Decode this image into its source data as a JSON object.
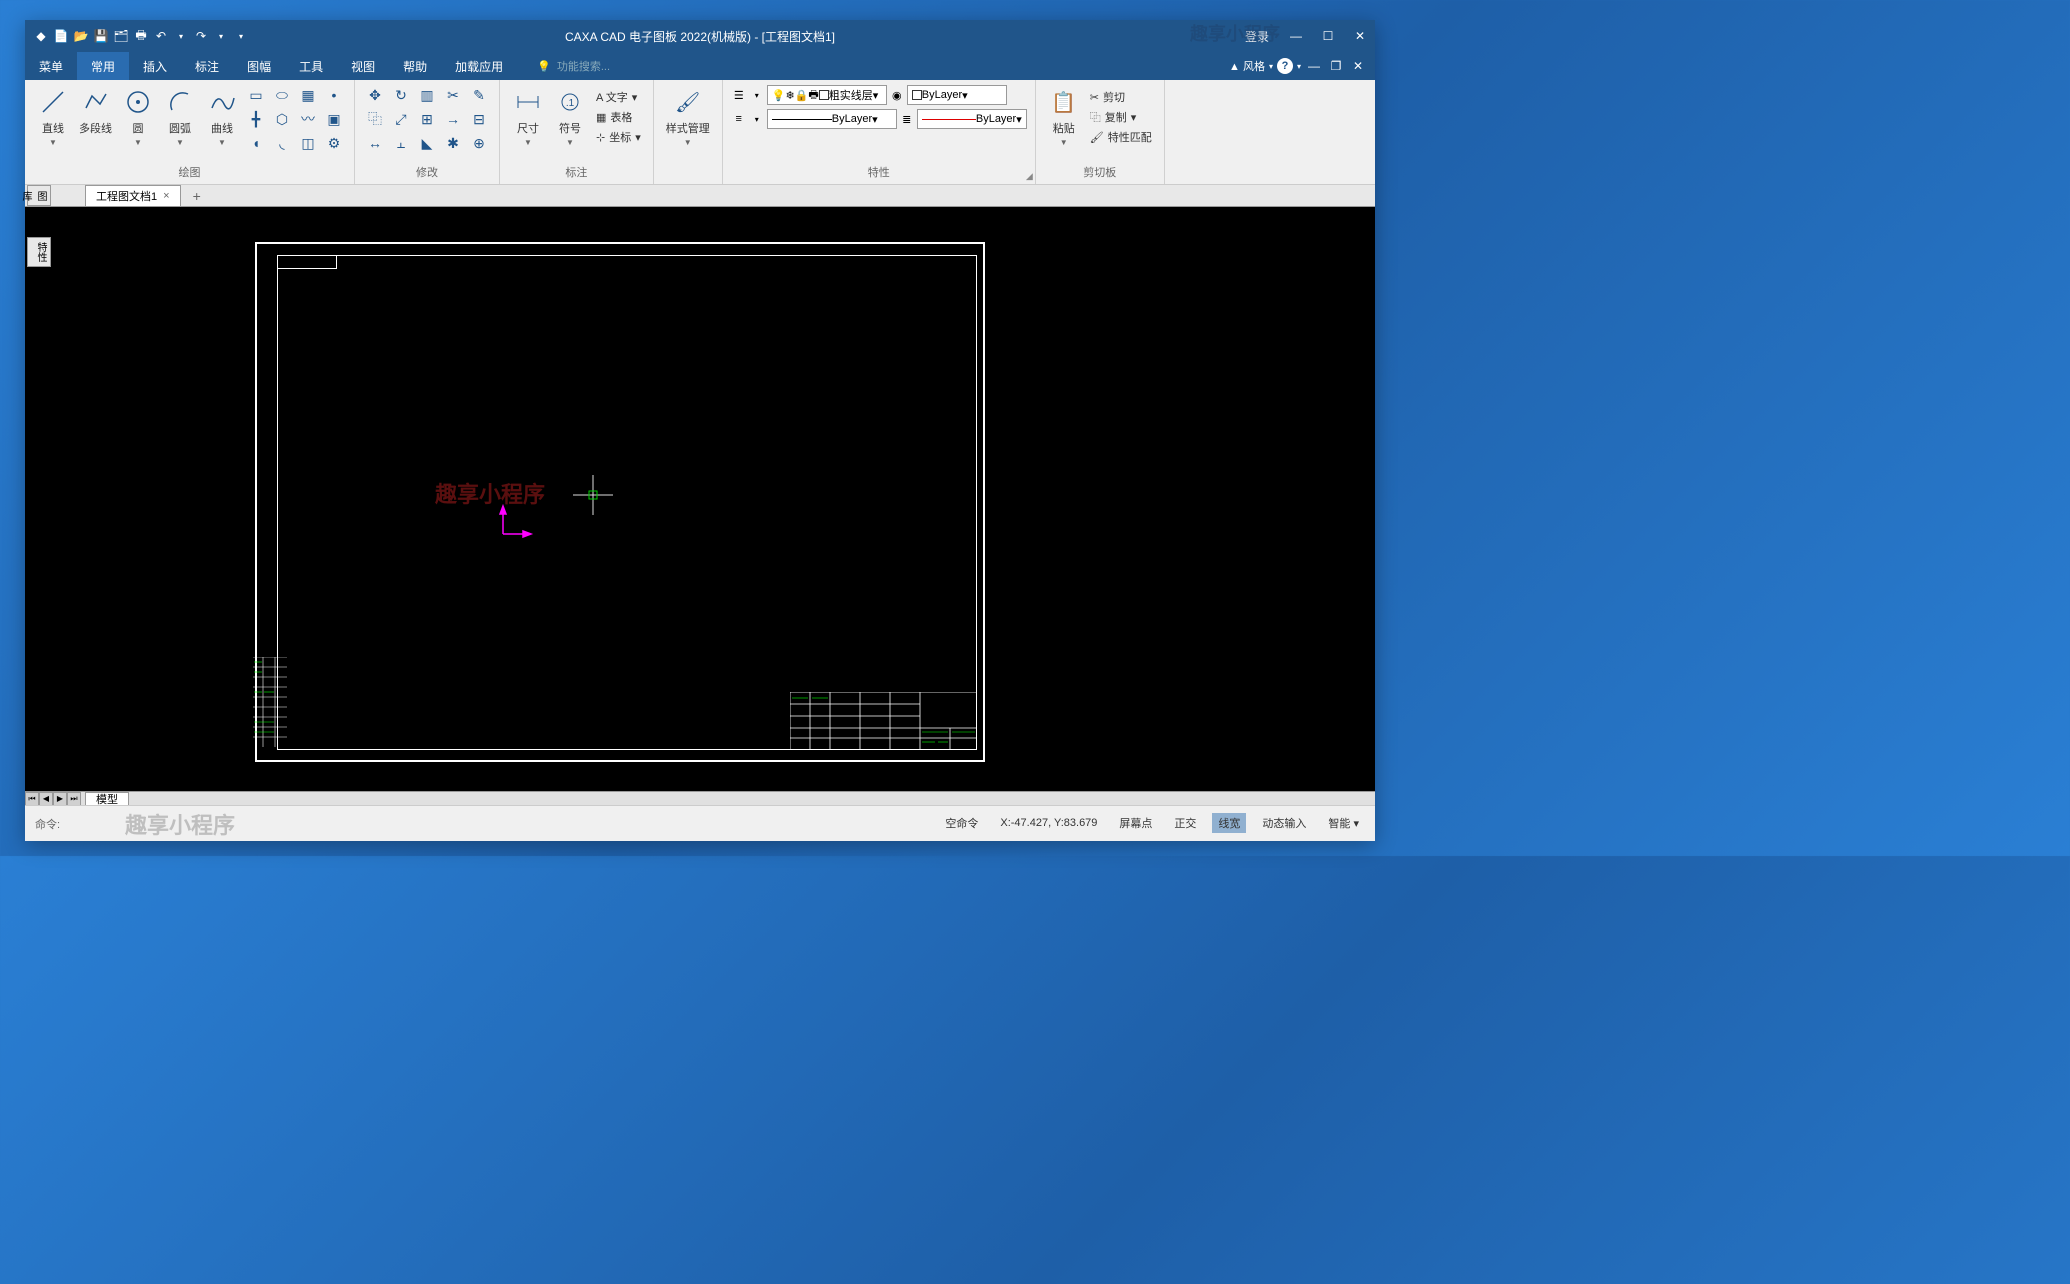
{
  "title": "CAXA CAD 电子图板 2022(机械版) - [工程图文档1]",
  "titlebar": {
    "login": "登录"
  },
  "menubar": {
    "items": [
      "菜单",
      "常用",
      "插入",
      "标注",
      "图幅",
      "工具",
      "视图",
      "帮助",
      "加载应用"
    ],
    "active_index": 1,
    "search_placeholder": "功能搜索...",
    "style": "▲ 风格"
  },
  "ribbon": {
    "draw": {
      "label": "绘图",
      "line": "直线",
      "polyline": "多段线",
      "circle": "圆",
      "arc": "圆弧",
      "curve": "曲线"
    },
    "modify": {
      "label": "修改"
    },
    "annotate": {
      "label": "标注",
      "dimension": "尺寸",
      "symbol": "符号",
      "text": "A 文字",
      "table": "表格",
      "coord": "坐标"
    },
    "style": {
      "label": "",
      "button": "样式管理"
    },
    "properties": {
      "label": "特性",
      "layer": "粗实线层",
      "color": "ByLayer",
      "linetype": "ByLayer",
      "lineweight": "ByLayer"
    },
    "clipboard": {
      "label": "剪切板",
      "paste": "粘贴",
      "cut": "剪切",
      "copy": "复制",
      "match": "特性匹配"
    }
  },
  "side": {
    "library": "图库",
    "properties": "特性"
  },
  "tabs": {
    "doc": "工程图文档1",
    "model": "模型"
  },
  "command": {
    "prompt": "命令:",
    "empty": "空命令"
  },
  "status": {
    "coords": "X:-47.427, Y:83.679",
    "screen_point": "屏幕点",
    "ortho": "正交",
    "lineweight": "线宽",
    "dynamic_input": "动态输入",
    "snap": "智能"
  },
  "watermark": "趣享小程序"
}
